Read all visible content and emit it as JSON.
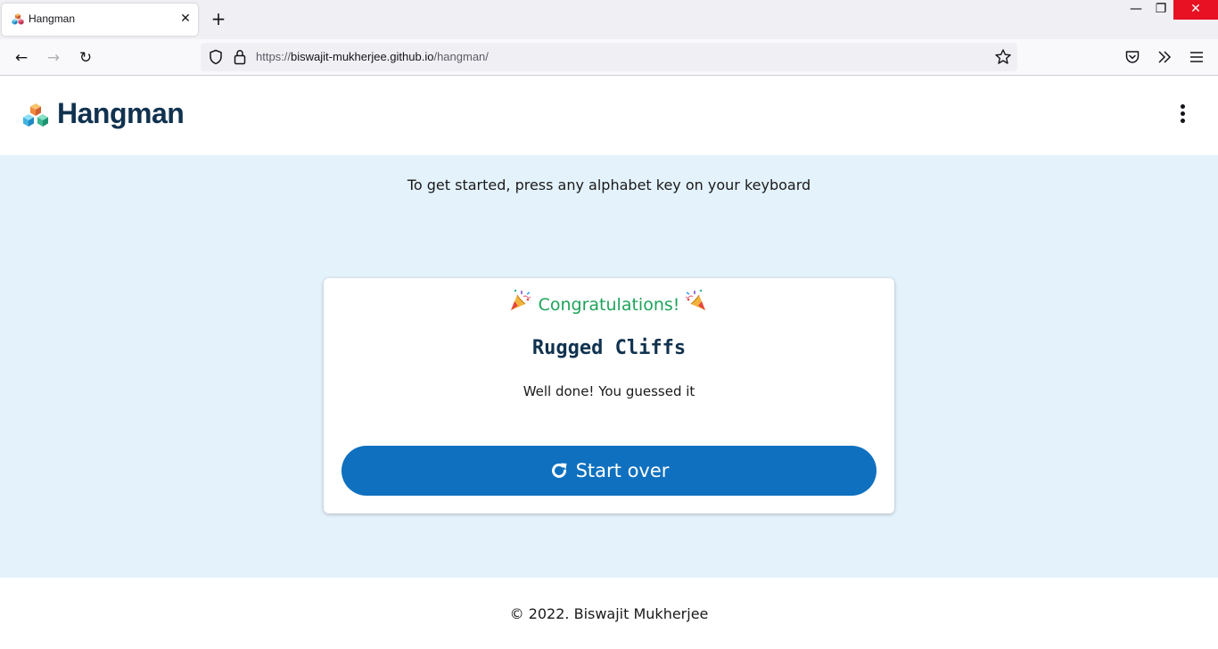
{
  "browser": {
    "tab": {
      "title": "Hangman",
      "close_glyph": "✕"
    },
    "new_tab_glyph": "+",
    "window_controls": {
      "minimize": "—",
      "maximize": "❐",
      "close": "✕"
    },
    "nav": {
      "back": "←",
      "forward": "→",
      "reload": "↻"
    },
    "url": {
      "scheme": "https://",
      "host": "biswajit-mukherjee.github.io",
      "path": "/hangman/"
    },
    "icons": [
      "shield-icon",
      "lock-icon",
      "star-icon",
      "pocket-icon",
      "extensions-overflow-icon",
      "menu-icon"
    ]
  },
  "header": {
    "brand": "Hangman",
    "logo_icon": "stacked-cubes-icon",
    "menu_icon": "kebab-menu-icon"
  },
  "main": {
    "instructions": "To get started, press any alphabet key on your keyboard",
    "result": {
      "heading": "Congratulations!",
      "heading_icon": "party-popper-icon",
      "answer": "Rugged Cliffs",
      "message": "Well done! You guessed it",
      "start_over_label": "Start over",
      "start_over_icon": "redo-icon"
    }
  },
  "footer": {
    "copyright": "© 2022. Biswajit Mukherjee"
  },
  "colors": {
    "page_bg": "#e4f2fc",
    "brand": "#10324f",
    "success": "#1ea35a",
    "button": "#0f70bf",
    "window_close": "#e81123"
  }
}
